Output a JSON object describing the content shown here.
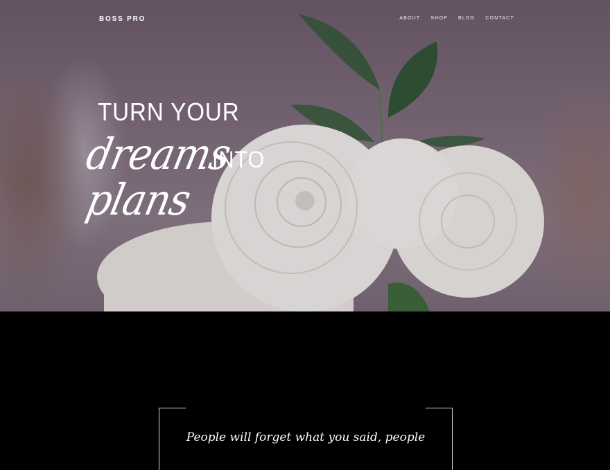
{
  "nav": {
    "brand": "BOSS PRO",
    "links": [
      "ABOUT",
      "SHOP",
      "BLOG",
      "CONTACT"
    ]
  },
  "hero": {
    "line1": "TURN YOUR",
    "script1": "dreams",
    "into": "INTO",
    "script2": "plans",
    "image": "white-flower-cake-photo"
  },
  "quote": {
    "text": "People will forget what you said, people"
  },
  "colors": {
    "background": "#000000",
    "text": "#ffffff",
    "frame": "#d9d9d9"
  }
}
